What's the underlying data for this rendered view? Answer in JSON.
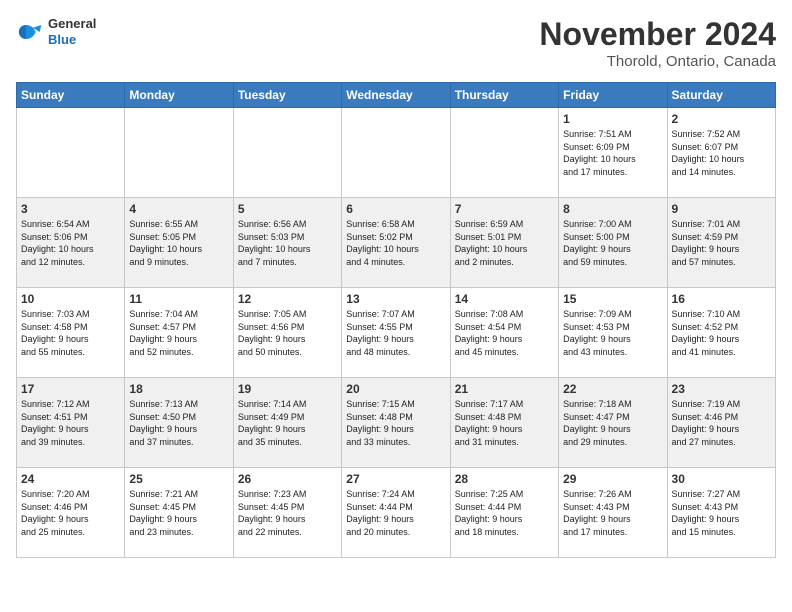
{
  "header": {
    "logo_general": "General",
    "logo_blue": "Blue",
    "title": "November 2024",
    "subtitle": "Thorold, Ontario, Canada"
  },
  "days_of_week": [
    "Sunday",
    "Monday",
    "Tuesday",
    "Wednesday",
    "Thursday",
    "Friday",
    "Saturday"
  ],
  "weeks": [
    [
      {
        "day": "",
        "info": ""
      },
      {
        "day": "",
        "info": ""
      },
      {
        "day": "",
        "info": ""
      },
      {
        "day": "",
        "info": ""
      },
      {
        "day": "",
        "info": ""
      },
      {
        "day": "1",
        "info": "Sunrise: 7:51 AM\nSunset: 6:09 PM\nDaylight: 10 hours\nand 17 minutes."
      },
      {
        "day": "2",
        "info": "Sunrise: 7:52 AM\nSunset: 6:07 PM\nDaylight: 10 hours\nand 14 minutes."
      }
    ],
    [
      {
        "day": "3",
        "info": "Sunrise: 6:54 AM\nSunset: 5:06 PM\nDaylight: 10 hours\nand 12 minutes."
      },
      {
        "day": "4",
        "info": "Sunrise: 6:55 AM\nSunset: 5:05 PM\nDaylight: 10 hours\nand 9 minutes."
      },
      {
        "day": "5",
        "info": "Sunrise: 6:56 AM\nSunset: 5:03 PM\nDaylight: 10 hours\nand 7 minutes."
      },
      {
        "day": "6",
        "info": "Sunrise: 6:58 AM\nSunset: 5:02 PM\nDaylight: 10 hours\nand 4 minutes."
      },
      {
        "day": "7",
        "info": "Sunrise: 6:59 AM\nSunset: 5:01 PM\nDaylight: 10 hours\nand 2 minutes."
      },
      {
        "day": "8",
        "info": "Sunrise: 7:00 AM\nSunset: 5:00 PM\nDaylight: 9 hours\nand 59 minutes."
      },
      {
        "day": "9",
        "info": "Sunrise: 7:01 AM\nSunset: 4:59 PM\nDaylight: 9 hours\nand 57 minutes."
      }
    ],
    [
      {
        "day": "10",
        "info": "Sunrise: 7:03 AM\nSunset: 4:58 PM\nDaylight: 9 hours\nand 55 minutes."
      },
      {
        "day": "11",
        "info": "Sunrise: 7:04 AM\nSunset: 4:57 PM\nDaylight: 9 hours\nand 52 minutes."
      },
      {
        "day": "12",
        "info": "Sunrise: 7:05 AM\nSunset: 4:56 PM\nDaylight: 9 hours\nand 50 minutes."
      },
      {
        "day": "13",
        "info": "Sunrise: 7:07 AM\nSunset: 4:55 PM\nDaylight: 9 hours\nand 48 minutes."
      },
      {
        "day": "14",
        "info": "Sunrise: 7:08 AM\nSunset: 4:54 PM\nDaylight: 9 hours\nand 45 minutes."
      },
      {
        "day": "15",
        "info": "Sunrise: 7:09 AM\nSunset: 4:53 PM\nDaylight: 9 hours\nand 43 minutes."
      },
      {
        "day": "16",
        "info": "Sunrise: 7:10 AM\nSunset: 4:52 PM\nDaylight: 9 hours\nand 41 minutes."
      }
    ],
    [
      {
        "day": "17",
        "info": "Sunrise: 7:12 AM\nSunset: 4:51 PM\nDaylight: 9 hours\nand 39 minutes."
      },
      {
        "day": "18",
        "info": "Sunrise: 7:13 AM\nSunset: 4:50 PM\nDaylight: 9 hours\nand 37 minutes."
      },
      {
        "day": "19",
        "info": "Sunrise: 7:14 AM\nSunset: 4:49 PM\nDaylight: 9 hours\nand 35 minutes."
      },
      {
        "day": "20",
        "info": "Sunrise: 7:15 AM\nSunset: 4:48 PM\nDaylight: 9 hours\nand 33 minutes."
      },
      {
        "day": "21",
        "info": "Sunrise: 7:17 AM\nSunset: 4:48 PM\nDaylight: 9 hours\nand 31 minutes."
      },
      {
        "day": "22",
        "info": "Sunrise: 7:18 AM\nSunset: 4:47 PM\nDaylight: 9 hours\nand 29 minutes."
      },
      {
        "day": "23",
        "info": "Sunrise: 7:19 AM\nSunset: 4:46 PM\nDaylight: 9 hours\nand 27 minutes."
      }
    ],
    [
      {
        "day": "24",
        "info": "Sunrise: 7:20 AM\nSunset: 4:46 PM\nDaylight: 9 hours\nand 25 minutes."
      },
      {
        "day": "25",
        "info": "Sunrise: 7:21 AM\nSunset: 4:45 PM\nDaylight: 9 hours\nand 23 minutes."
      },
      {
        "day": "26",
        "info": "Sunrise: 7:23 AM\nSunset: 4:45 PM\nDaylight: 9 hours\nand 22 minutes."
      },
      {
        "day": "27",
        "info": "Sunrise: 7:24 AM\nSunset: 4:44 PM\nDaylight: 9 hours\nand 20 minutes."
      },
      {
        "day": "28",
        "info": "Sunrise: 7:25 AM\nSunset: 4:44 PM\nDaylight: 9 hours\nand 18 minutes."
      },
      {
        "day": "29",
        "info": "Sunrise: 7:26 AM\nSunset: 4:43 PM\nDaylight: 9 hours\nand 17 minutes."
      },
      {
        "day": "30",
        "info": "Sunrise: 7:27 AM\nSunset: 4:43 PM\nDaylight: 9 hours\nand 15 minutes."
      }
    ]
  ]
}
